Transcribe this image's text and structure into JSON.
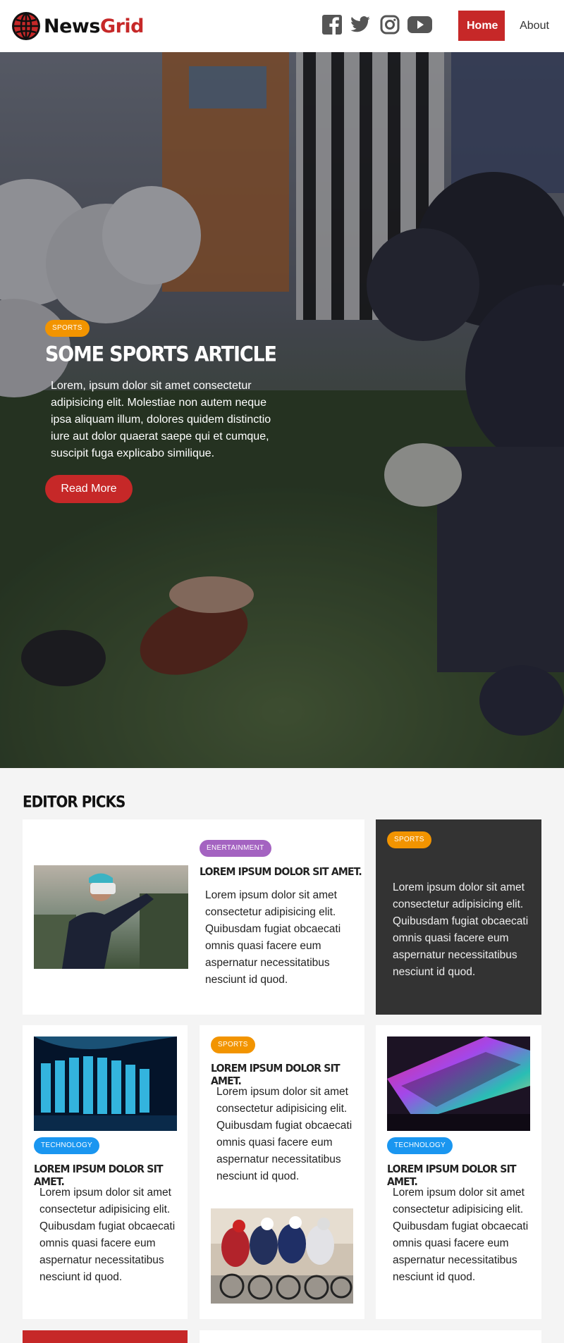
{
  "brand": {
    "name_part1": "News",
    "name_part2": "Grid",
    "accent": "#c62828"
  },
  "nav": {
    "social": [
      "facebook-icon",
      "twitter-icon",
      "instagram-icon",
      "youtube-icon"
    ],
    "links": [
      {
        "label": "Home",
        "active": true
      },
      {
        "label": "About",
        "active": false
      }
    ]
  },
  "hero": {
    "category": "SPORTS",
    "title": "SOME SPORTS ARTICLE",
    "text": "Lorem, ipsum dolor sit amet consectetur adipisicing elit. Molestiae non autem neque ipsa aliquam illum, dolores quidem distinctio iure aut dolor quaerat saepe qui et cumque, suscipit fuga explicabo similique.",
    "button": "Read More"
  },
  "editor_picks": {
    "title": "EDITOR PICKS",
    "cards": [
      {
        "category": "ENERTAINMENT",
        "title": "LOREM IPSUM DOLOR SIT AMET.",
        "text": "Lorem ipsum dolor sit amet consectetur adipisicing elit. Quibusdam fugiat obcaecati omnis quasi facere eum aspernatur necessitatibus nesciunt id quod."
      },
      {
        "category": "SPORTS",
        "text": "Lorem ipsum dolor sit amet consectetur adipisicing elit. Quibusdam fugiat obcaecati omnis quasi facere eum aspernatur necessitatibus nesciunt id quod."
      },
      {
        "category": "TECHNOLOGY",
        "title": "LOREM IPSUM DOLOR SIT AMET.",
        "text": "Lorem ipsum dolor sit amet consectetur adipisicing elit. Quibusdam fugiat obcaecati omnis quasi facere eum aspernatur necessitatibus nesciunt id quod."
      },
      {
        "category": "SPORTS",
        "title": "LOREM IPSUM DOLOR SIT AMET.",
        "text": "Lorem ipsum dolor sit amet consectetur adipisicing elit. Quibusdam fugiat obcaecati omnis quasi facere eum aspernatur necessitatibus nesciunt id quod."
      },
      {
        "category": "TECHNOLOGY",
        "title": "LOREM IPSUM DOLOR SIT AMET.",
        "text": "Lorem ipsum dolor sit amet consectetur adipisicing elit. Quibusdam fugiat obcaecati omnis quasi facere eum aspernatur necessitatibus nesciunt id quod."
      }
    ]
  },
  "colors": {
    "sports": "#f29400",
    "entertainment": "#a463c1",
    "technology": "#1a96f0",
    "dark_card": "#333333"
  }
}
